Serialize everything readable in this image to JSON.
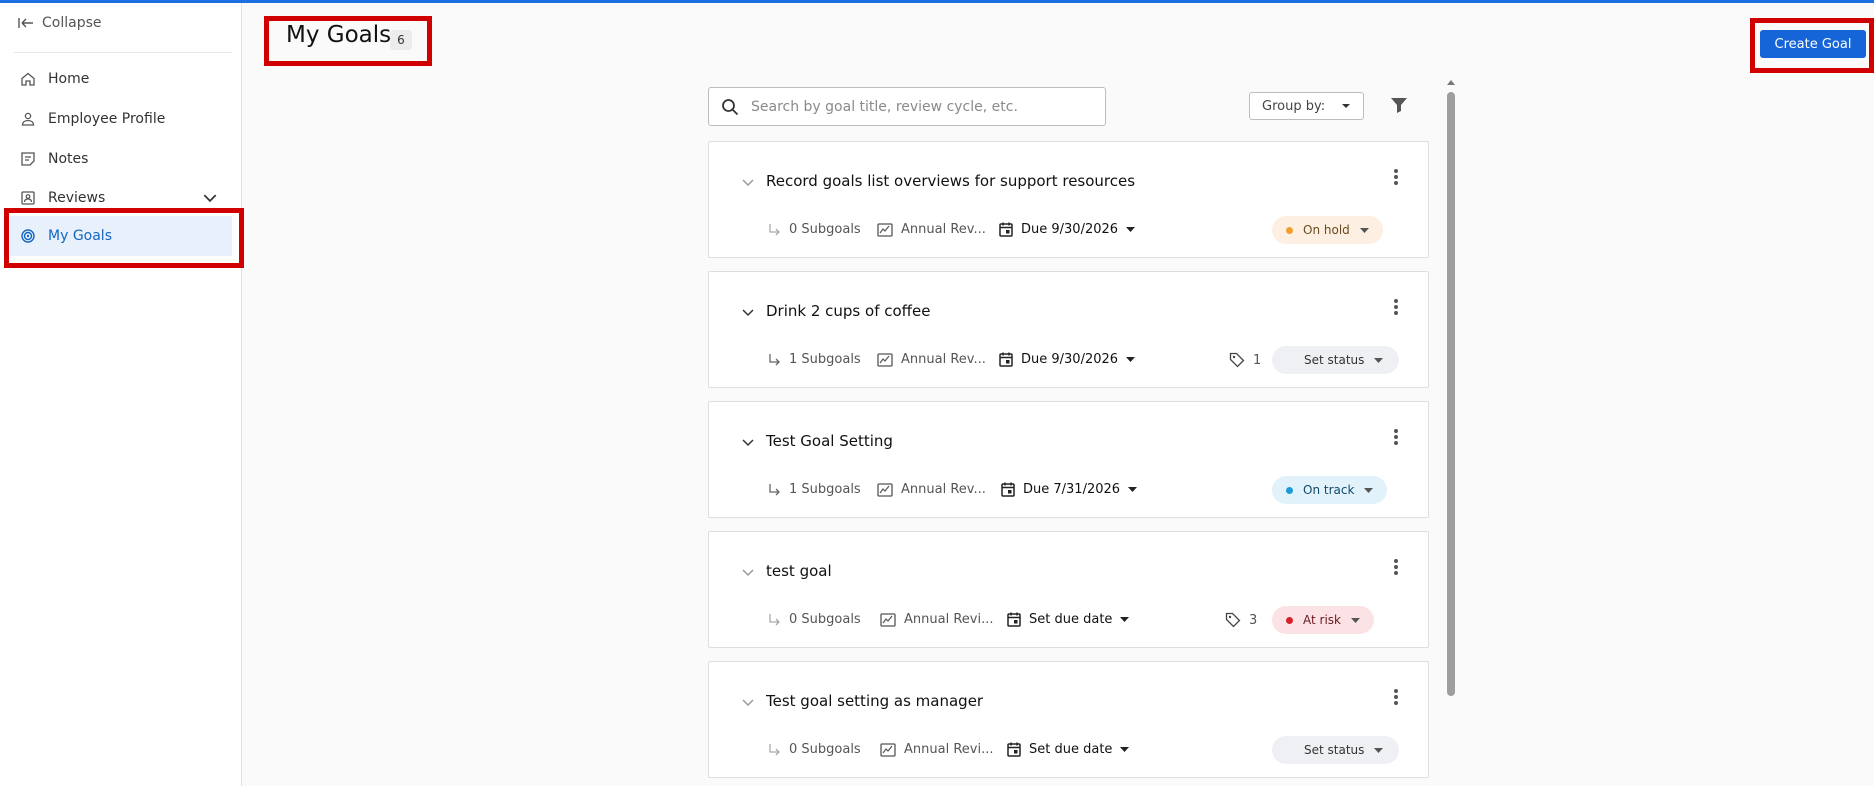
{
  "sidebar": {
    "collapse_label": "Collapse",
    "items": [
      {
        "label": "Home",
        "icon": "home-icon"
      },
      {
        "label": "Employee Profile",
        "icon": "person-icon"
      },
      {
        "label": "Notes",
        "icon": "notes-icon"
      },
      {
        "label": "Reviews",
        "icon": "reviews-icon"
      },
      {
        "label": "My Goals",
        "icon": "goal-target-icon",
        "active": true
      }
    ]
  },
  "header": {
    "title": "My Goals",
    "count": "6",
    "create_label": "Create Goal"
  },
  "toolbar": {
    "search_placeholder": "Search by goal title, review cycle, etc.",
    "group_by_label": "Group by:"
  },
  "goals": [
    {
      "title": "Record goals list overviews for support resources",
      "subgoals": "0 Subgoals",
      "cycle": "Annual Rev...",
      "due": "Due 9/30/2026",
      "tags": "",
      "status": "On hold"
    },
    {
      "title": "Drink 2 cups of coffee",
      "subgoals": "1 Subgoals",
      "cycle": "Annual Rev...",
      "due": "Due 9/30/2026",
      "tags": "1",
      "status": "Set status"
    },
    {
      "title": "Test Goal Setting",
      "subgoals": "1 Subgoals",
      "cycle": "Annual Rev...",
      "due": "Due 7/31/2026",
      "tags": "",
      "status": "On track"
    },
    {
      "title": "test goal",
      "subgoals": "0 Subgoals",
      "cycle": "Annual Revi...",
      "due": "Set due date",
      "tags": "3",
      "status": "At risk"
    },
    {
      "title": "Test goal setting as manager",
      "subgoals": "0 Subgoals",
      "cycle": "Annual Revi...",
      "due": "Set due date",
      "tags": "",
      "status": "Set status"
    }
  ],
  "colors": {
    "accent": "#1565d8",
    "on_hold_bg": "#fdf0e2",
    "on_hold_dot": "#f0a030",
    "on_track_bg": "#e1f2fb",
    "on_track_dot": "#1a9ad8",
    "at_risk_bg": "#fbe3e5",
    "at_risk_dot": "#d8202a",
    "set_status_bg": "#eef0f3"
  }
}
